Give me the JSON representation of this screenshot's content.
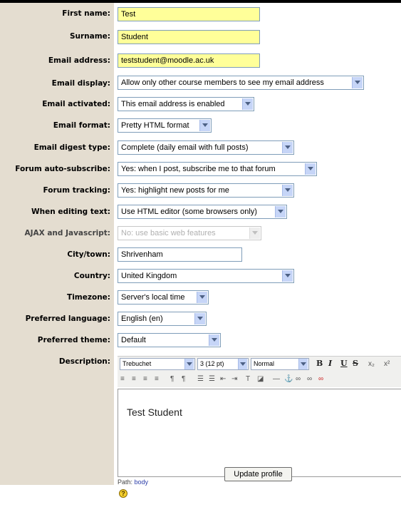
{
  "form": {
    "fields": [
      {
        "label": "First name:",
        "value": "Test"
      },
      {
        "label": "Surname:",
        "value": "Student"
      },
      {
        "label": "Email address:",
        "value": "teststudent@moodle.ac.uk"
      },
      {
        "label": "Email display:",
        "value": "Allow only other course members to see my email address"
      },
      {
        "label": "Email activated:",
        "value": "This email address is enabled"
      },
      {
        "label": "Email format:",
        "value": "Pretty HTML format"
      },
      {
        "label": "Email digest type:",
        "value": "Complete (daily email with full posts)"
      },
      {
        "label": "Forum auto-subscribe:",
        "value": "Yes: when I post, subscribe me to that forum"
      },
      {
        "label": "Forum tracking:",
        "value": "Yes: highlight new posts for me"
      },
      {
        "label": "When editing text:",
        "value": "Use HTML editor (some browsers only)"
      },
      {
        "label": "AJAX and Javascript:",
        "value": "No: use basic web features"
      },
      {
        "label": "City/town:",
        "value": "Shrivenham"
      },
      {
        "label": "Country:",
        "value": "United Kingdom"
      },
      {
        "label": "Timezone:",
        "value": "Server's local time"
      },
      {
        "label": "Preferred language:",
        "value": "English (en)"
      },
      {
        "label": "Preferred theme:",
        "value": "Default"
      }
    ],
    "description_label": "Description:"
  },
  "editor": {
    "font": "Trebuchet",
    "size": "3 (12 pt)",
    "format": "Normal",
    "content": "Test Student",
    "path_label": "Path:",
    "path_value": "body",
    "bold": "B",
    "italic": "I",
    "underline": "U",
    "strike": "S"
  },
  "submit_label": "Update profile",
  "help_glyph": "?",
  "colors": {
    "highlight": "#ffff99",
    "label_bg": "#e4ddd0"
  }
}
